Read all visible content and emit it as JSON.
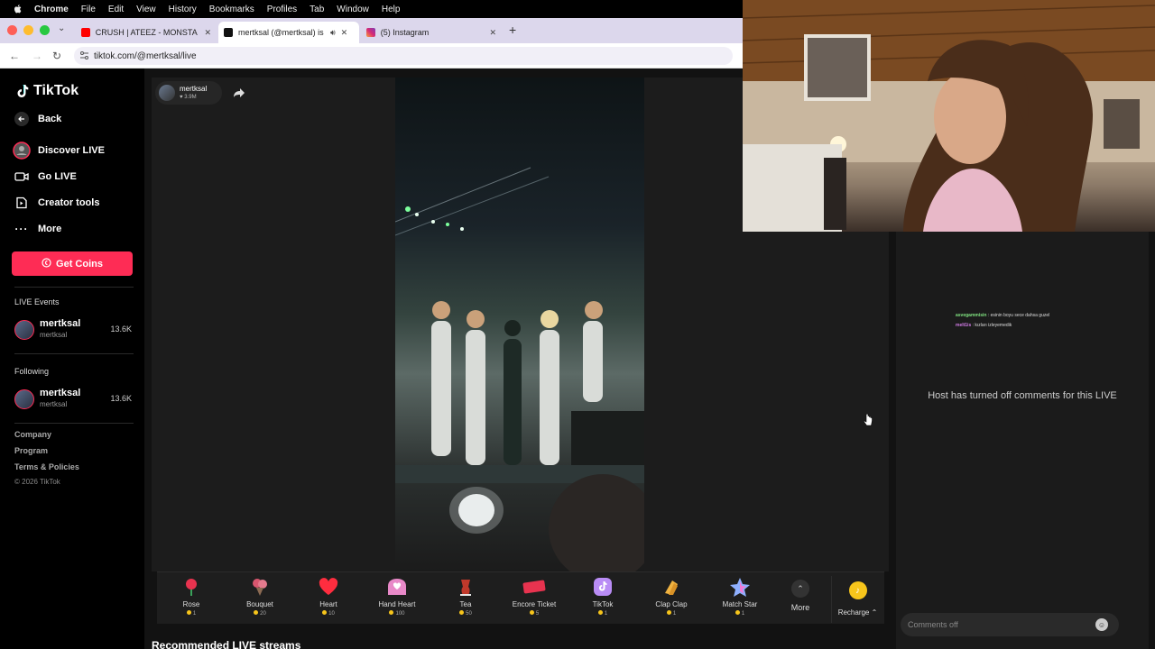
{
  "menubar": {
    "app": "Chrome",
    "items": [
      "File",
      "Edit",
      "View",
      "History",
      "Bookmarks",
      "Profiles",
      "Tab",
      "Window",
      "Help"
    ]
  },
  "tabs": [
    {
      "title": "CRUSH | ATEEZ - MONSTA X",
      "icon": "youtube-icon",
      "active": false
    },
    {
      "title": "mertksal (@mertksal) is L",
      "icon": "tiktok-icon",
      "active": true
    },
    {
      "title": "(5) Instagram",
      "icon": "instagram-icon",
      "active": false
    }
  ],
  "address": {
    "url": "tiktok.com/@mertksal/live"
  },
  "sidebar": {
    "logo": "TikTok",
    "back": "Back",
    "nav": [
      {
        "label": "Discover LIVE",
        "icon": "live-avatar-icon"
      },
      {
        "label": "Go LIVE",
        "icon": "camera-icon"
      },
      {
        "label": "Creator tools",
        "icon": "creator-icon"
      },
      {
        "label": "More",
        "icon": "more-dots-icon"
      }
    ],
    "get_coins": "Get Coins",
    "live_events_heading": "LIVE Events",
    "live_events": [
      {
        "name": "mertksal",
        "handle": "mertksal",
        "count": "13.6K"
      }
    ],
    "following_heading": "Following",
    "following": [
      {
        "name": "mertksal",
        "handle": "mertksal",
        "count": "13.6K"
      }
    ],
    "footer_links": [
      "Company",
      "Program",
      "Terms & Policies"
    ],
    "copyright": "© 2026 TikTok"
  },
  "host": {
    "name": "mertksal",
    "likes": "3.9M"
  },
  "gifts": [
    {
      "name": "Rose",
      "price": "1",
      "icon": "rose-icon",
      "color": "#e8334f"
    },
    {
      "name": "Bouquet",
      "price": "20",
      "icon": "bouquet-icon",
      "color": "#d9566e"
    },
    {
      "name": "Heart",
      "price": "10",
      "icon": "heart-icon",
      "color": "#ff2d3f"
    },
    {
      "name": "Hand Heart",
      "price": "100",
      "icon": "hand-heart-icon",
      "color": "#e889c8"
    },
    {
      "name": "Tea",
      "price": "50",
      "icon": "tea-icon",
      "color": "#c0392b"
    },
    {
      "name": "Encore Ticket",
      "price": "5",
      "icon": "ticket-icon",
      "color": "#e8334f"
    },
    {
      "name": "TikTok",
      "price": "1",
      "icon": "tiktok-gift-icon",
      "color": "#b98cf5"
    },
    {
      "name": "Clap Clap",
      "price": "1",
      "icon": "clap-icon",
      "color": "#f0b341"
    },
    {
      "name": "Match Star",
      "price": "1",
      "icon": "star-icon",
      "color": "#8fb0ff"
    }
  ],
  "gift_more": "More",
  "recharge": "Recharge ⌃",
  "recommended_heading": "Recommended LIVE streams",
  "chat": {
    "messages": [
      {
        "user": "asvegammisin",
        "text": ": esinin boyu sece dahsa guzel"
      },
      {
        "user": "melt1is",
        "text": ": kızları izleyemedik"
      }
    ],
    "comments_off_notice": "Host has turned off comments for this LIVE",
    "input_placeholder": "Comments off"
  },
  "colors": {
    "brand": "#fe2c55",
    "coin": "#f7c51b",
    "tab_strip": "#dcd7ec"
  }
}
